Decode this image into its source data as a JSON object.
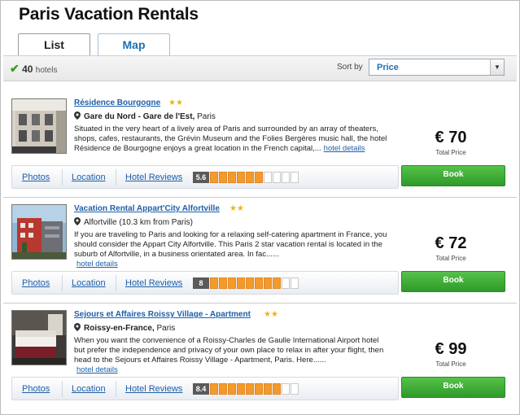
{
  "page": {
    "title": "Paris Vacation Rentals"
  },
  "tabs": [
    {
      "label": "List"
    },
    {
      "label": "Map"
    }
  ],
  "toolbar": {
    "count": "40",
    "count_unit": "hotels",
    "sort_label": "Sort by",
    "sort_value": "Price"
  },
  "colors": {
    "link": "#1f5fa8",
    "book_green": "#3aa832",
    "rating_orange": "#f39a2c",
    "star": "#f0b400"
  },
  "listings": [
    {
      "name": "Résidence Bourgogne",
      "stars": "★★",
      "star_count": 2,
      "location_bold": "Gare du Nord - Gare de l'Est,",
      "location_rest": " Paris",
      "description": "Situated in the very heart of a lively area of Paris and surrounded by an array of theaters, shops, cafes, restaurants, the Grévin Museum and the Folies Bergères music hall, the hotel Résidence de Bourgogne enjoys a great location in the French capital,...",
      "details_link": "hotel details",
      "price": "€ 70",
      "price_label": "Total Price",
      "links": {
        "photos": "Photos",
        "location": "Location",
        "reviews": "Hotel Reviews"
      },
      "rating": "5.6",
      "rating_filled": 6,
      "book": "Book"
    },
    {
      "name": "Vacation Rental Appart'City Alfortville",
      "stars": "★★",
      "star_count": 2,
      "location_bold": "",
      "location_rest": "Alfortville (10.3 km from Paris)",
      "description": "If you are traveling to Paris and looking for a relaxing self-catering apartment in France, you should consider the Appart City Alfortville. This Paris 2 star vacation rental is located in the suburb of Alfortville, in a business orientated area. In fac......",
      "details_link": "hotel details",
      "price": "€ 72",
      "price_label": "Total Price",
      "links": {
        "photos": "Photos",
        "location": "Location",
        "reviews": "Hotel Reviews"
      },
      "rating": "8",
      "rating_filled": 8,
      "book": "Book"
    },
    {
      "name": "Sejours et Affaires Roissy Village - Apartment",
      "stars": "★★",
      "star_count": 2,
      "location_bold": "Roissy-en-France,",
      "location_rest": " Paris",
      "description": "When you want the convenience of a Roissy-Charles de Gaulle International Airport hotel but prefer the independence and privacy of your own place to relax in after your flight, then head to the Sejours et Affaires Roissy Village - Apartment, Paris. Here......",
      "details_link": "hotel details",
      "price": "€ 99",
      "price_label": "Total Price",
      "links": {
        "photos": "Photos",
        "location": "Location",
        "reviews": "Hotel Reviews"
      },
      "rating": "8.4",
      "rating_filled": 8,
      "book": "Book"
    }
  ]
}
